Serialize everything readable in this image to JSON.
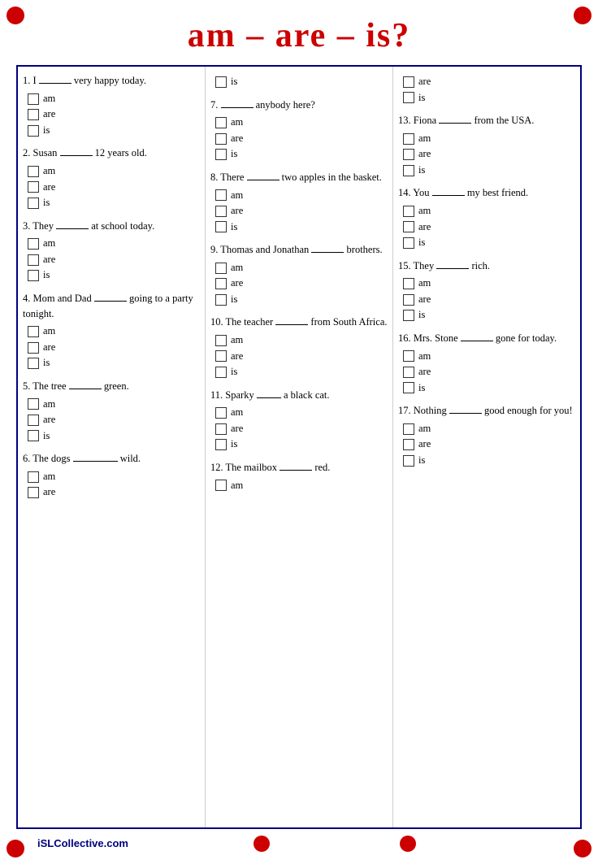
{
  "title": "am – are – is?",
  "colors": {
    "red": "#cc0000",
    "navy": "#000080"
  },
  "footer": "iSLCollective.com",
  "columns": [
    {
      "questions": [
        {
          "id": "q1",
          "text": "1. I _____ very happy today.",
          "options": [
            "am",
            "are",
            "is"
          ]
        },
        {
          "id": "q2",
          "text": "2. Susan _______ 12 years old.",
          "options": [
            "am",
            "are",
            "is"
          ]
        },
        {
          "id": "q3",
          "text": "3. They _____ at school today.",
          "options": [
            "am",
            "are",
            "is"
          ]
        },
        {
          "id": "q4",
          "text": "4. Mom and Dad _______ going to a party tonight.",
          "options": [
            "am",
            "are",
            "is"
          ]
        },
        {
          "id": "q5",
          "text": "5. The tree _____ green.",
          "options": [
            "am",
            "are",
            "is"
          ]
        },
        {
          "id": "q6",
          "text": "6. The dogs ________ wild.",
          "options": [
            "am",
            "are"
          ]
        }
      ]
    },
    {
      "questions": [
        {
          "id": "q6b",
          "text": "",
          "pre_options": [
            "is"
          ]
        },
        {
          "id": "q7",
          "text": "7. _____ anybody here?",
          "options": [
            "am",
            "are",
            "is"
          ]
        },
        {
          "id": "q8",
          "text": "8. There _______ two apples in the basket.",
          "options": [
            "am",
            "are",
            "is"
          ]
        },
        {
          "id": "q9",
          "text": "9. Thomas and Jonathan _______ brothers.",
          "options": [
            "am",
            "are",
            "is"
          ]
        },
        {
          "id": "q10",
          "text": "10. The teacher _______ from South Africa.",
          "options": [
            "am",
            "are",
            "is"
          ]
        },
        {
          "id": "q11",
          "text": "11. Sparky ____ a black cat.",
          "options": [
            "am",
            "are",
            "is"
          ]
        },
        {
          "id": "q12",
          "text": "12. The mailbox _____ red.",
          "options": [
            "am"
          ]
        }
      ]
    },
    {
      "questions": [
        {
          "id": "q12b",
          "text": "",
          "pre_options": [
            "are",
            "is"
          ]
        },
        {
          "id": "q13",
          "text": "13. Fiona _______ from the USA.",
          "options": [
            "am",
            "are",
            "is"
          ]
        },
        {
          "id": "q14",
          "text": "14. You _____ my best friend.",
          "options": [
            "am",
            "are",
            "is"
          ]
        },
        {
          "id": "q15",
          "text": "15. They _______ rich.",
          "options": [
            "am",
            "are",
            "is"
          ]
        },
        {
          "id": "q16",
          "text": "16. Mrs. Stone _____ gone for today.",
          "options": [
            "am",
            "are",
            "is"
          ]
        },
        {
          "id": "q17",
          "text": "17. Nothing _____ good enough for you!",
          "options": [
            "am",
            "are",
            "is"
          ]
        }
      ]
    }
  ]
}
